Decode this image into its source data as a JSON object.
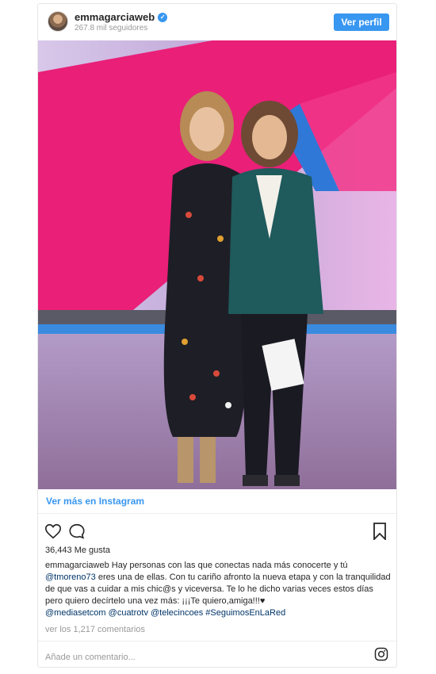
{
  "header": {
    "username": "emmagarciaweb",
    "followers": "267.8 mil seguidores",
    "view_profile": "Ver perfil"
  },
  "links": {
    "view_on_instagram": "Ver más en Instagram"
  },
  "stats": {
    "likes": "36,443 Me gusta"
  },
  "caption": {
    "username": "emmagarciaweb",
    "text1": "Hay personas con las que conectas nada más conocerte y tú",
    "mention1": "@tmoreno73",
    "text2": "eres una de ellas. Con tu cariño afronto la nueva etapa y con la tranquilidad de que vas a cuidar a mis chic@s y viceversa. Te lo he dicho varias veces estos días pero quiero decírtelo una vez más: ¡¡¡Te quiero,amiga!!!♥",
    "mention2": "@mediasetcom",
    "mention3": "@cuatrotv",
    "mention4": "@telecincoes",
    "hashtag": "#SeguimosEnLaRed"
  },
  "comments": {
    "view_all": "ver los 1,217 comentarios",
    "add_placeholder": "Añade un comentario..."
  },
  "colors": {
    "accent": "#3897f0",
    "mention": "#003569",
    "muted": "#999999"
  },
  "icons": {
    "like": "heart-icon",
    "comment": "comment-icon",
    "save": "bookmark-icon",
    "instagram": "instagram-icon",
    "verified": "verified-badge-icon"
  }
}
